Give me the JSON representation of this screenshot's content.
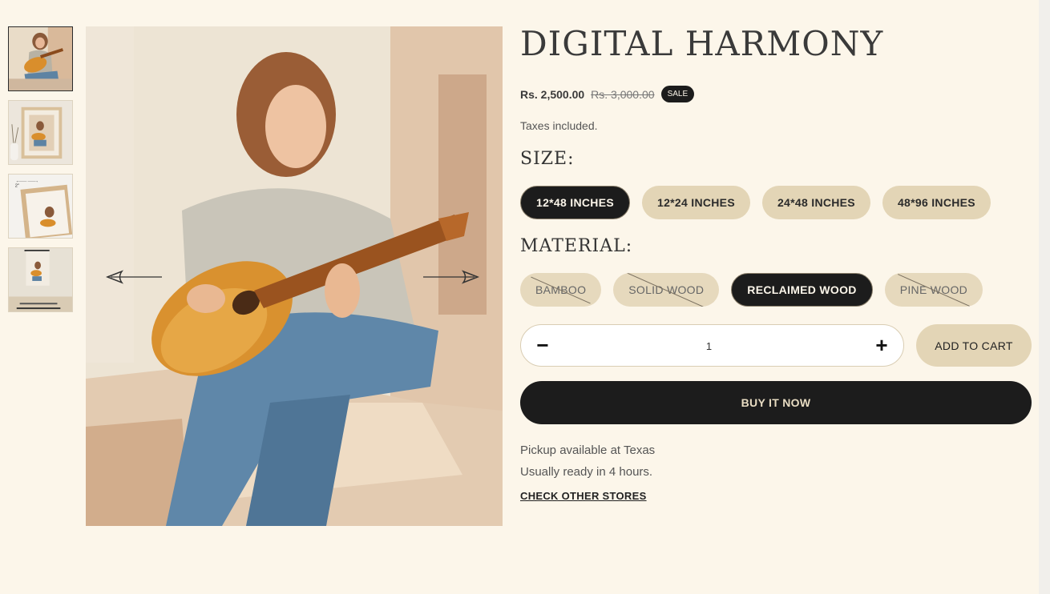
{
  "product": {
    "title": "DIGITAL HARMONY",
    "price": "Rs. 2,500.00",
    "compare_price": "Rs. 3,000.00",
    "sale_badge": "SALE",
    "tax_note": "Taxes included."
  },
  "gallery": {
    "thumbnails": [
      "thumb-painting",
      "thumb-framed-room",
      "thumb-framed-size",
      "thumb-wall-poster"
    ],
    "active_index": 0,
    "prev_icon": "arrow-left-icon",
    "next_icon": "arrow-right-icon"
  },
  "size": {
    "label": "SIZE:",
    "options": [
      {
        "label": "12*48 INCHES",
        "selected": true
      },
      {
        "label": "12*24 INCHES",
        "selected": false
      },
      {
        "label": "24*48 INCHES",
        "selected": false
      },
      {
        "label": "48*96 INCHES",
        "selected": false
      }
    ]
  },
  "material": {
    "label": "MATERIAL:",
    "options": [
      {
        "label": "BAMBOO",
        "selected": false,
        "unavailable": true
      },
      {
        "label": "SOLID WOOD",
        "selected": false,
        "unavailable": true
      },
      {
        "label": "RECLAIMED WOOD",
        "selected": true,
        "unavailable": false
      },
      {
        "label": "PINE WOOD",
        "selected": false,
        "unavailable": true
      }
    ]
  },
  "quantity": {
    "value": "1",
    "minus": "−",
    "plus": "+"
  },
  "actions": {
    "add_to_cart": "ADD TO CART",
    "buy_now": "BUY IT NOW"
  },
  "pickup": {
    "available": "Pickup available at Texas",
    "ready": "Usually ready in 4 hours.",
    "link": "CHECK OTHER STORES"
  },
  "colors": {
    "background": "#fcf6ea",
    "dark": "#1c1c1c",
    "beige": "#e3d5b6"
  }
}
